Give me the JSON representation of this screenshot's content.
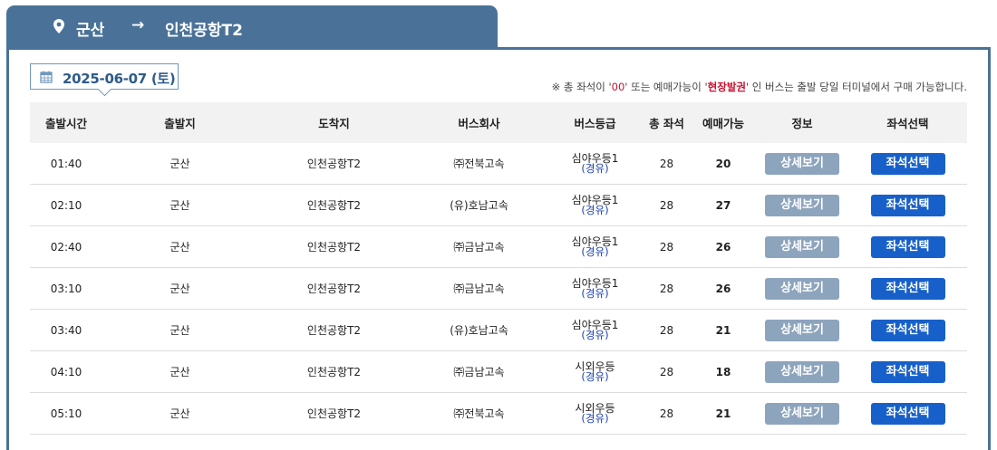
{
  "route": {
    "from": "군산",
    "arrow": "→",
    "to": "인천공항T2"
  },
  "date": {
    "value": "2025-06-07 (토)"
  },
  "notice": {
    "prefix": "※ 총 좌석이 '",
    "zero": "00",
    "middle": "' 또는 예매가능이 '",
    "onsite": "현장발권",
    "suffix": "' 인 버스는 출발 당일 터미널에서 구매 가능합니다."
  },
  "table": {
    "headers": [
      "출발시간",
      "출발지",
      "도착지",
      "버스회사",
      "버스등급",
      "총 좌석",
      "예매가능",
      "정보",
      "좌석선택"
    ],
    "rows": [
      {
        "time": "01:40",
        "from": "군산",
        "to": "인천공항T2",
        "company": "㈜전북고속",
        "grade": "심야우등1",
        "via": "(경유)",
        "total": "28",
        "available": "20",
        "info": "상세보기",
        "select": "좌석선택"
      },
      {
        "time": "02:10",
        "from": "군산",
        "to": "인천공항T2",
        "company": "(유)호남고속",
        "grade": "심야우등1",
        "via": "(경유)",
        "total": "28",
        "available": "27",
        "info": "상세보기",
        "select": "좌석선택"
      },
      {
        "time": "02:40",
        "from": "군산",
        "to": "인천공항T2",
        "company": "㈜금남고속",
        "grade": "심야우등1",
        "via": "(경유)",
        "total": "28",
        "available": "26",
        "info": "상세보기",
        "select": "좌석선택"
      },
      {
        "time": "03:10",
        "from": "군산",
        "to": "인천공항T2",
        "company": "㈜금남고속",
        "grade": "심야우등1",
        "via": "(경유)",
        "total": "28",
        "available": "26",
        "info": "상세보기",
        "select": "좌석선택"
      },
      {
        "time": "03:40",
        "from": "군산",
        "to": "인천공항T2",
        "company": "(유)호남고속",
        "grade": "심야우등1",
        "via": "(경유)",
        "total": "28",
        "available": "21",
        "info": "상세보기",
        "select": "좌석선택"
      },
      {
        "time": "04:10",
        "from": "군산",
        "to": "인천공항T2",
        "company": "㈜금남고속",
        "grade": "시외우등",
        "via": "(경유)",
        "total": "28",
        "available": "18",
        "info": "상세보기",
        "select": "좌석선택"
      },
      {
        "time": "05:10",
        "from": "군산",
        "to": "인천공항T2",
        "company": "㈜전북고속",
        "grade": "시외우등",
        "via": "(경유)",
        "total": "28",
        "available": "21",
        "info": "상세보기",
        "select": "좌석선택"
      }
    ]
  },
  "icons": {
    "location": "map-pin-icon",
    "calendar": "calendar-icon",
    "arrow": "right-arrow-icon"
  },
  "colors": {
    "header": "#4a7298",
    "primary_button": "#1760c9",
    "secondary_button": "#8da4bd",
    "notice_red": "#c8102e",
    "via_blue": "#1a3fb0"
  }
}
